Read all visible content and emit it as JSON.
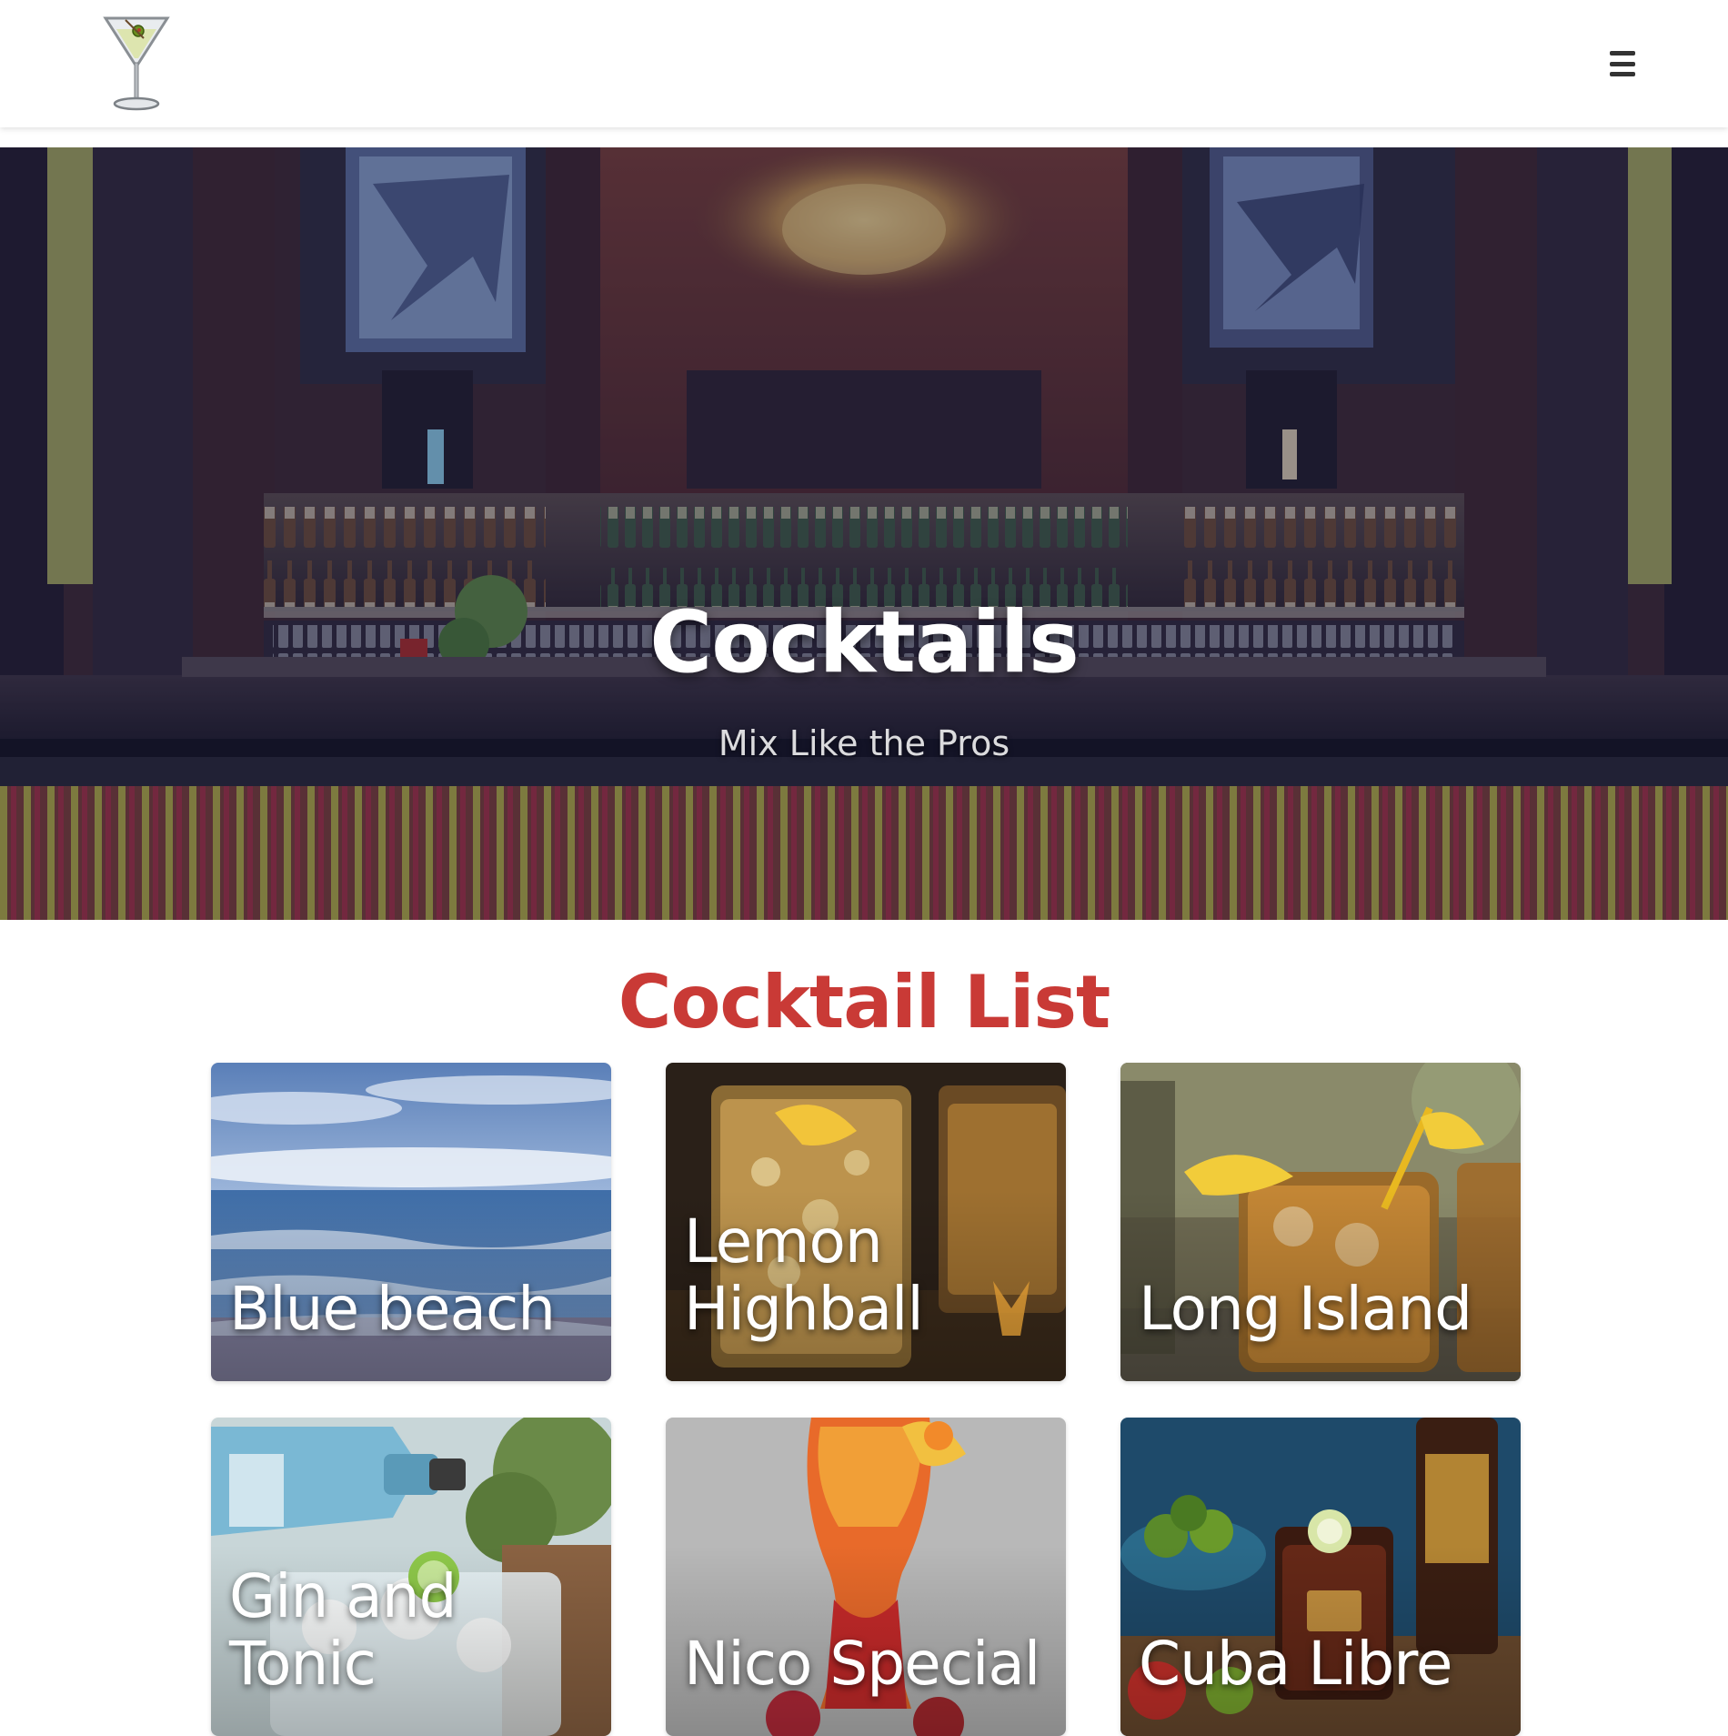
{
  "header": {
    "logo": "martini-glass-icon",
    "menu_icon": "hamburger-menu-icon"
  },
  "hero": {
    "title": "Cocktails",
    "subtitle": "Mix Like the Pros"
  },
  "cocktail_list": {
    "title": "Cocktail List",
    "items": [
      {
        "name": "Blue beach"
      },
      {
        "name": "Lemon Highball"
      },
      {
        "name": "Long Island"
      },
      {
        "name": "Gin and Tonic"
      },
      {
        "name": "Nico Special"
      },
      {
        "name": "Cuba Libre"
      }
    ]
  },
  "colors": {
    "accent": "#c93a36",
    "header_bg": "#ffffff",
    "hero_overlay": "#1e2046"
  }
}
